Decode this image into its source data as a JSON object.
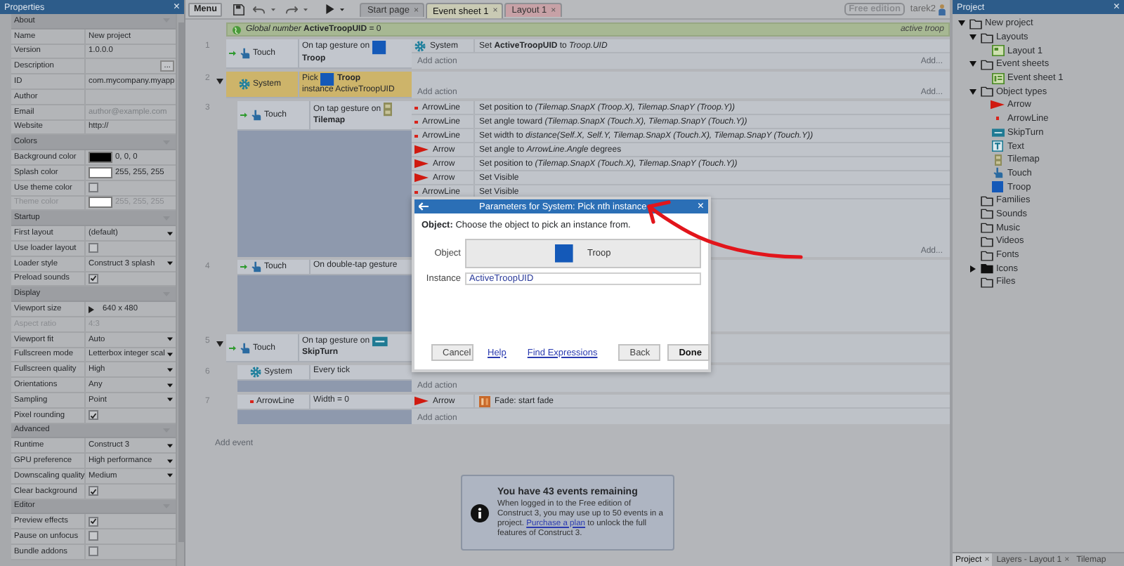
{
  "properties": {
    "title": "Properties",
    "close": "×",
    "sections": [
      {
        "title": "About",
        "rows": [
          {
            "kind": "text",
            "label": "Name",
            "value": "New project",
            "disabled": false
          },
          {
            "kind": "text",
            "label": "Version",
            "value": "1.0.0.0",
            "disabled": false
          },
          {
            "kind": "button",
            "label": "Description",
            "button": "...",
            "disabled": false
          },
          {
            "kind": "text",
            "label": "ID",
            "value": "com.mycompany.myapp",
            "disabled": false
          },
          {
            "kind": "text",
            "label": "Author",
            "disabled": false
          },
          {
            "kind": "text",
            "label": "Email",
            "placeholder": "author@example.com",
            "disabled": false
          },
          {
            "kind": "text",
            "label": "Website",
            "value": "http://",
            "disabled": false
          }
        ]
      },
      {
        "title": "Colors",
        "rows": [
          {
            "kind": "color",
            "label": "Background color",
            "color": "#000000",
            "value": "0, 0, 0",
            "disabled": false
          },
          {
            "kind": "color",
            "label": "Splash color",
            "color": "#ffffff",
            "value": "255, 255, 255",
            "disabled": false
          },
          {
            "kind": "checkbox",
            "label": "Use theme color",
            "checked": false,
            "disabled": false
          },
          {
            "kind": "color",
            "label": "Theme color",
            "color": "#ffffff",
            "value": "255, 255, 255",
            "disabled": true
          }
        ]
      },
      {
        "title": "Startup",
        "rows": [
          {
            "kind": "select",
            "label": "First layout",
            "value": "(default)",
            "disabled": false
          },
          {
            "kind": "checkbox",
            "label": "Use loader layout",
            "checked": false,
            "disabled": false
          },
          {
            "kind": "select",
            "label": "Loader style",
            "value": "Construct 3 splash",
            "disabled": false
          },
          {
            "kind": "checkbox",
            "label": "Preload sounds",
            "checked": true,
            "disabled": false
          }
        ]
      },
      {
        "title": "Display",
        "rows": [
          {
            "kind": "expand",
            "label": "Viewport size",
            "value": "640 x 480",
            "disabled": false
          },
          {
            "kind": "text",
            "label": "Aspect ratio",
            "value": "4:3",
            "disabled": true
          },
          {
            "kind": "select",
            "label": "Viewport fit",
            "value": "Auto",
            "disabled": false
          },
          {
            "kind": "select",
            "label": "Fullscreen mode",
            "value": "Letterbox integer scal",
            "disabled": false
          },
          {
            "kind": "select",
            "label": "Fullscreen quality",
            "value": "High",
            "disabled": false
          },
          {
            "kind": "select",
            "label": "Orientations",
            "value": "Any",
            "disabled": false
          },
          {
            "kind": "select",
            "label": "Sampling",
            "value": "Point",
            "disabled": false
          },
          {
            "kind": "checkbox",
            "label": "Pixel rounding",
            "checked": true,
            "disabled": false
          }
        ]
      },
      {
        "title": "Advanced",
        "rows": [
          {
            "kind": "select",
            "label": "Runtime",
            "value": "Construct 3",
            "disabled": false
          },
          {
            "kind": "select",
            "label": "GPU preference",
            "value": "High performance",
            "disabled": false
          },
          {
            "kind": "select",
            "label": "Downscaling quality",
            "value": "Medium",
            "disabled": false
          },
          {
            "kind": "checkbox",
            "label": "Clear background",
            "checked": true,
            "disabled": false
          }
        ]
      },
      {
        "title": "Editor",
        "rows": [
          {
            "kind": "checkbox",
            "label": "Preview effects",
            "checked": true,
            "disabled": false
          },
          {
            "kind": "checkbox",
            "label": "Pause on unfocus",
            "checked": false,
            "disabled": false
          },
          {
            "kind": "checkbox",
            "label": "Bundle addons",
            "checked": false,
            "disabled": false
          }
        ]
      }
    ]
  },
  "toolbar": {
    "menu": "Menu",
    "tabs": [
      {
        "label": "Start page",
        "close": "×",
        "selected": false,
        "color": "#a4a6aa"
      },
      {
        "label": "Event sheet 1",
        "close": "×",
        "selected": true,
        "color": "#c9cab4"
      },
      {
        "label": "Layout 1",
        "close": "×",
        "selected": false,
        "color": "#c7a1a6"
      }
    ],
    "edition": "Free edition",
    "user": "tarek2"
  },
  "event_sheet": {
    "global_variable": "*Global number* **ActiveTroopUID** = 0",
    "global_comment": "active troop",
    "add_event": "Add event",
    "events": [
      {
        "number": "1",
        "selected": false,
        "conditions": [
          {
            "object": "Touch",
            "kind": "touch",
            "trigger": true,
            "text": "On tap gesture on",
            "target": {
              "kind": "troop",
              "name": "Troop"
            }
          }
        ],
        "actions": [
          {
            "object": "System",
            "kind": "system",
            "text": "Set **ActiveTroopUID** to *Troop.UID*"
          }
        ],
        "add_action": "Add action",
        "add_more": "Add..."
      },
      {
        "number": "2",
        "selected": true,
        "expanded": true,
        "conditions": [
          {
            "object": "System",
            "kind": "system",
            "trigger": false,
            "text": "Pick",
            "target": {
              "kind": "troop",
              "name": "Troop"
            },
            "after": "instance ActiveTroopUID"
          }
        ],
        "add_action": "Add action",
        "add_more": "Add...",
        "children": [
          {
            "number": "3",
            "selected": false,
            "conditions": [
              {
                "object": "Touch",
                "kind": "touch",
                "trigger": true,
                "text": "On tap gesture on",
                "target": {
                  "kind": "tilemap",
                  "name": "Tilemap"
                }
              }
            ],
            "actions": [
              {
                "object": "ArrowLine",
                "kind": "arrowline",
                "text": "Set position to *(Tilemap.SnapX (Troop.X), Tilemap.SnapY (Troop.Y))*"
              },
              {
                "object": "ArrowLine",
                "kind": "arrowline",
                "text": "Set angle toward *(Tilemap.SnapX (Touch.X), Tilemap.SnapY (Touch.Y))*"
              },
              {
                "object": "ArrowLine",
                "kind": "arrowline",
                "text": "Set width to *distance(Self.X, Self.Y, Tilemap.SnapX (Touch.X), Tilemap.SnapY (Touch.Y))*"
              },
              {
                "object": "Arrow",
                "kind": "arrow",
                "text": "Set angle to *ArrowLine.Angle* degrees"
              },
              {
                "object": "Arrow",
                "kind": "arrow",
                "text": "Set position to *(Tilemap.SnapX (Touch.X), Tilemap.SnapY (Touch.Y))*"
              },
              {
                "object": "Arrow",
                "kind": "arrow",
                "text": "Set Visible"
              },
              {
                "object": "ArrowLine",
                "kind": "arrowline",
                "text": "Set Visible"
              }
            ],
            "add_more": "Add..."
          },
          {
            "number": "4",
            "selected": false,
            "conditions": [
              {
                "object": "Touch",
                "kind": "touch",
                "trigger": true,
                "text": "On double-tap gesture"
              }
            ]
          }
        ]
      },
      {
        "number": "5",
        "selected": false,
        "expanded": true,
        "conditions": [
          {
            "object": "Touch",
            "kind": "touch",
            "trigger": true,
            "text": "On tap gesture on",
            "target": {
              "kind": "skipturn",
              "name": "SkipTurn"
            }
          }
        ],
        "children": [
          {
            "number": "6",
            "selected": false,
            "conditions": [
              {
                "object": "System",
                "kind": "system",
                "trigger": false,
                "text": "Every tick"
              }
            ],
            "add_action": "Add action"
          },
          {
            "number": "7",
            "selected": false,
            "conditions": [
              {
                "object": "ArrowLine",
                "kind": "arrowline",
                "trigger": false,
                "text": "Width = 0"
              }
            ],
            "actions": [
              {
                "object": "Arrow",
                "kind": "arrow",
                "behavior": {
                  "kind": "fade"
                },
                "text": "Fade: start fade"
              }
            ],
            "add_action": "Add action"
          }
        ]
      }
    ]
  },
  "dialog": {
    "title": "Parameters for System: Pick nth instance",
    "close": "×",
    "intro": "**Object:** Choose the object to pick an instance from.",
    "fields": [
      {
        "kind": "object",
        "label": "Object",
        "target": {
          "kind": "troop",
          "name": "Troop"
        }
      },
      {
        "kind": "text",
        "label": "Instance",
        "value": "ActiveTroopUID"
      }
    ],
    "buttons": [
      {
        "kind": "button",
        "label": "Cancel"
      },
      {
        "kind": "link",
        "label": "Help"
      },
      {
        "kind": "link",
        "label": "Find Expressions"
      },
      {
        "kind": "button",
        "label": "Back"
      },
      {
        "kind": "primary",
        "label": "Done"
      }
    ]
  },
  "notice": {
    "title": "You have 43 events remaining",
    "text": "When logged in to the Free edition of Construct 3, you may use up to 50 events in a project.",
    "link": "Purchase a plan",
    "after": "to unlock the full features of Construct 3."
  },
  "project": {
    "title": "Project",
    "close": "×",
    "tree": [
      {
        "label": "New project",
        "kind": "folder",
        "expanded": true,
        "children": [
          {
            "label": "Layouts",
            "kind": "folder",
            "expanded": true,
            "children": [
              {
                "label": "Layout 1",
                "kind": "layout"
              }
            ]
          },
          {
            "label": "Event sheets",
            "kind": "folder",
            "expanded": true,
            "children": [
              {
                "label": "Event sheet 1",
                "kind": "eventsheet"
              }
            ]
          },
          {
            "label": "Object types",
            "kind": "folder",
            "expanded": true,
            "children": [
              {
                "label": "Arrow",
                "kind": "arrow"
              },
              {
                "label": "ArrowLine",
                "kind": "arrowline"
              },
              {
                "label": "SkipTurn",
                "kind": "skipturn"
              },
              {
                "label": "Text",
                "kind": "text"
              },
              {
                "label": "Tilemap",
                "kind": "tilemap"
              },
              {
                "label": "Touch",
                "kind": "touch"
              },
              {
                "label": "Troop",
                "kind": "troop"
              }
            ]
          },
          {
            "label": "Families",
            "kind": "folder"
          },
          {
            "label": "Sounds",
            "kind": "folder"
          },
          {
            "label": "Music",
            "kind": "folder"
          },
          {
            "label": "Videos",
            "kind": "folder"
          },
          {
            "label": "Fonts",
            "kind": "folder"
          },
          {
            "label": "Icons",
            "kind": "special-folder",
            "expanded": false
          },
          {
            "label": "Files",
            "kind": "folder"
          }
        ]
      }
    ],
    "tabs": [
      {
        "label": "Project",
        "close": "×",
        "selected": true
      },
      {
        "label": "Layers - Layout 1",
        "close": "×",
        "selected": false
      },
      {
        "label": "Tilemap",
        "selected": false
      }
    ]
  }
}
